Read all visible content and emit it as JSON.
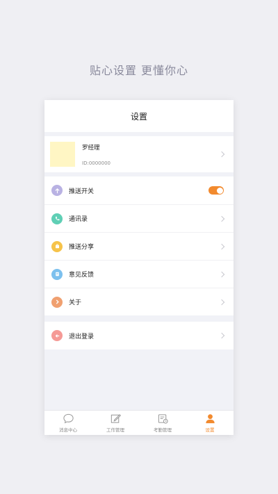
{
  "tagline": "贴心设置  更懂你心",
  "header": {
    "title": "设置"
  },
  "profile": {
    "name": "罗经理",
    "id_text": "ID:0000000"
  },
  "settings": [
    {
      "label": "推送开关",
      "icon": "upload-arrow-icon",
      "icon_color": "#b9b2e3",
      "toggle_on": true
    },
    {
      "label": "通讯录",
      "icon": "phone-icon",
      "icon_color": "#5fcfb5"
    },
    {
      "label": "推送分享",
      "icon": "share-box-icon",
      "icon_color": "#f6c34a"
    },
    {
      "label": "意见反馈",
      "icon": "note-icon",
      "icon_color": "#7cc0ee"
    },
    {
      "label": "关于",
      "icon": "chevron-right-icon",
      "icon_color": "#f0a070"
    }
  ],
  "logout": {
    "label": "退出登录",
    "icon": "arrow-left-icon",
    "icon_color": "#f59a96"
  },
  "tabbar": [
    {
      "label": "消息中心",
      "icon": "chat-bubble-icon",
      "active": false
    },
    {
      "label": "工作管理",
      "icon": "edit-icon",
      "active": false
    },
    {
      "label": "考勤管理",
      "icon": "attendance-icon",
      "active": false
    },
    {
      "label": "设置",
      "icon": "user-icon",
      "active": true
    }
  ],
  "colors": {
    "accent": "#f28a2e",
    "background": "#efeff3",
    "tagline": "#8a8a9c"
  }
}
